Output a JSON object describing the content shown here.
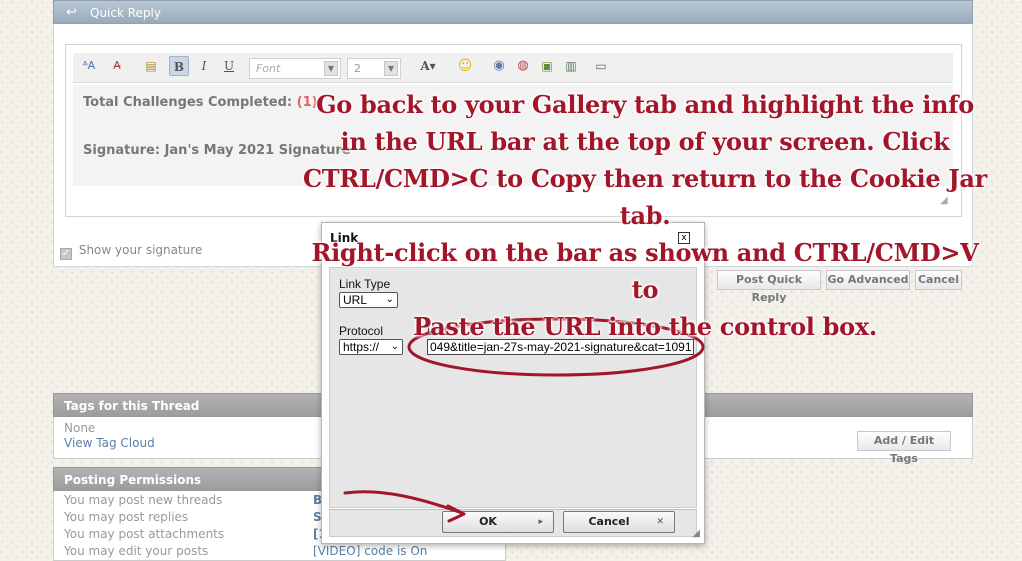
{
  "quick_reply": {
    "title": "Quick Reply",
    "editor": {
      "font_placeholder": "Font",
      "size_value": "2",
      "line1_label": "Total Challenges Completed: ",
      "line1_value": "(1)",
      "line2": "Signature: Jan's May 2021 Signature"
    },
    "show_signature_label": "Show your signature",
    "buttons": {
      "post": "Post Quick Reply",
      "advanced": "Go Advanced",
      "cancel": "Cancel"
    }
  },
  "tags_block": {
    "title": "Tags for this Thread",
    "none_text": "None",
    "view_cloud": "View Tag Cloud",
    "add_edit": "Add / Edit Tags"
  },
  "permissions_block": {
    "title": "Posting Permissions",
    "rows": [
      {
        "label": "You may post new threads",
        "value": "B"
      },
      {
        "label": "You may post replies",
        "value": "S"
      },
      {
        "label": "You may post attachments",
        "value": "[1"
      },
      {
        "label": "You may edit your posts",
        "value": "[VIDEO] code is On"
      }
    ]
  },
  "link_dialog": {
    "title": "Link",
    "close_glyph": "x",
    "link_type_label": "Link Type",
    "link_type_value": "URL",
    "protocol_label": "Protocol",
    "protocol_value": "https://",
    "url_label": "URL",
    "url_value": "049&title=jan-27s-may-2021-signature&cat=1091",
    "ok_label": "OK",
    "cancel_label": "Cancel"
  },
  "annotation": {
    "lines": [
      "Go back to your Gallery tab and highlight the info",
      "in the URL bar at the top of your screen. Click",
      "CTRL/CMD>C to Copy then return to the Cookie Jar tab.",
      "Right-click on the bar as shown and CTRL/CMD>V to",
      "Paste the URL into the control box."
    ],
    "color": "#a3162a"
  },
  "icons": [
    "reply-arrow-icon",
    "font-color-icon",
    "remove-format-icon",
    "paste-icon",
    "bold-icon",
    "italic-icon",
    "underline-icon",
    "text-color-icon",
    "smiley-icon",
    "link-icon",
    "unlink-icon",
    "image-icon",
    "video-icon",
    "quote-icon",
    "checkbox-icon",
    "dropdown-arrow-icon",
    "close-icon",
    "ok-arrow-icon",
    "cancel-x-icon",
    "resize-grip-icon"
  ]
}
